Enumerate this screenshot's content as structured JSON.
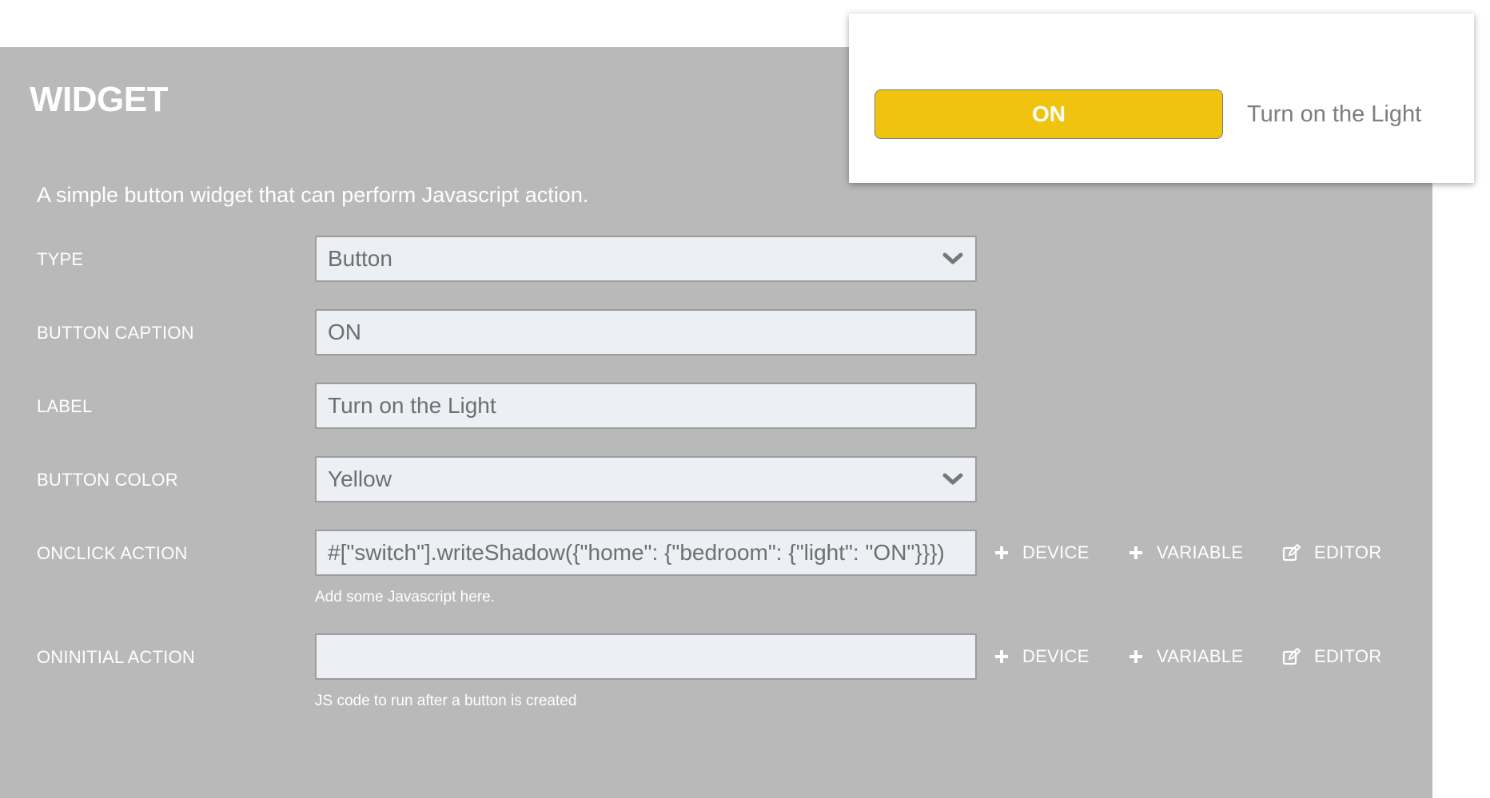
{
  "panel": {
    "title": "WIDGET",
    "description": "A simple button widget that can perform Javascript action."
  },
  "fields": {
    "type": {
      "label": "TYPE",
      "value": "Button"
    },
    "caption": {
      "label": "BUTTON CAPTION",
      "value": "ON"
    },
    "label": {
      "label": "LABEL",
      "value": "Turn on the Light"
    },
    "color": {
      "label": "BUTTON COLOR",
      "value": "Yellow"
    },
    "onclick": {
      "label": "ONCLICK ACTION",
      "value": "#[\"switch\"].writeShadow({\"home\": {\"bedroom\": {\"light\": \"ON\"}}})",
      "hint": "Add some Javascript here."
    },
    "oninitial": {
      "label": "ONINITIAL ACTION",
      "value": "",
      "hint": "JS code to run after a button is created"
    }
  },
  "actions": {
    "device": "DEVICE",
    "variable": "VARIABLE",
    "editor": "EDITOR"
  },
  "preview": {
    "button_caption": "ON",
    "label": "Turn on the Light"
  },
  "colors": {
    "panel_bg": "#b9b9b9",
    "field_bg": "#eceff4",
    "button_yellow": "#f0c30f"
  },
  "icons": {
    "select": "chevron-down-icon",
    "add": "plus-icon",
    "editor": "edit-icon"
  }
}
